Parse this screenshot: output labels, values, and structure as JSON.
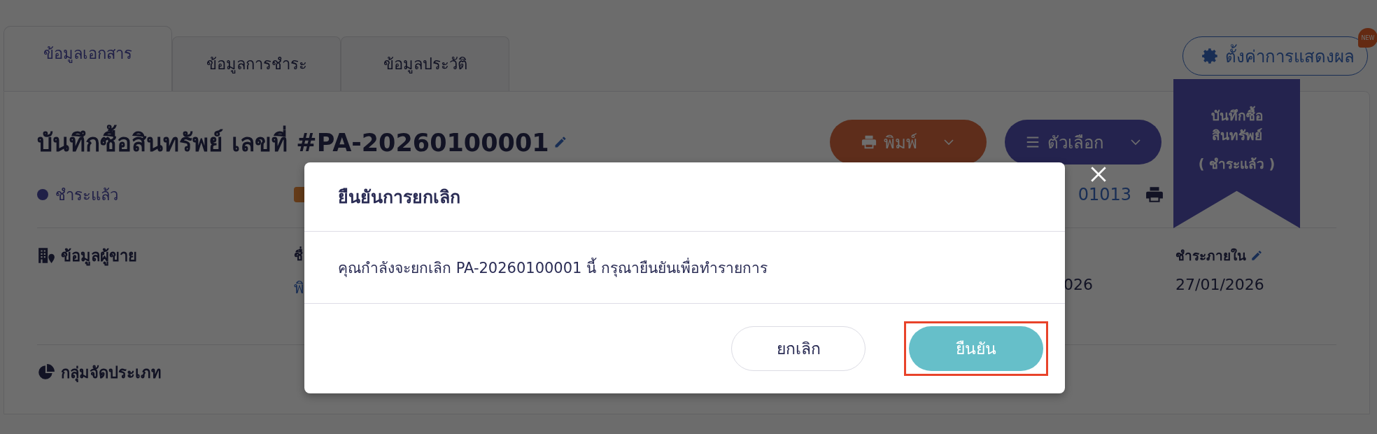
{
  "tabs": [
    {
      "label": "ข้อมูลเอกสาร",
      "selected": true
    },
    {
      "label": "ข้อมูลการชำระ",
      "selected": false
    },
    {
      "label": "ข้อมูลประวัติ",
      "selected": false
    }
  ],
  "display_settings_button": {
    "label": "ตั้งค่าการแสดงผล",
    "badge": "NEW"
  },
  "ribbon": {
    "lines": [
      "บันทึกซื้อ",
      "สินทรัพย์"
    ],
    "status": "( ชำระแล้ว )"
  },
  "document": {
    "title": "บันทึกซื้อสินทรัพย์ เลขที่ #PA-20260100001",
    "status": {
      "label": "ชำระแล้ว"
    },
    "reference": "01013"
  },
  "buttons": [
    {
      "label": "พิมพ์",
      "kind": "print"
    },
    {
      "label": "ตัวเลือก",
      "kind": "options"
    }
  ],
  "sections": [
    {
      "title": "ข้อมูลผู้ขาย",
      "kind": "vendor",
      "fields": [
        {
          "label": "ชื่",
          "value": "พิ",
          "link": true
        },
        {
          "value": "026",
          "link": false
        },
        {
          "label": "ชำระภายใน",
          "value": "27/01/2026",
          "editable": true,
          "link": false
        }
      ]
    },
    {
      "title": "กลุ่มจัดประเภท",
      "kind": "category"
    }
  ],
  "dialog": {
    "title": "ยืนยันการยกเลิก",
    "message": "คุณกำลังจะยกเลิก PA-20260100001 นี้ กรุณายืนยันเพื่อทำรายการ",
    "buttons": [
      {
        "label": "ยกเลิก",
        "kind": "secondary",
        "highlighted": false
      },
      {
        "label": "ยืนยัน",
        "kind": "primary",
        "highlighted": true
      }
    ]
  }
}
